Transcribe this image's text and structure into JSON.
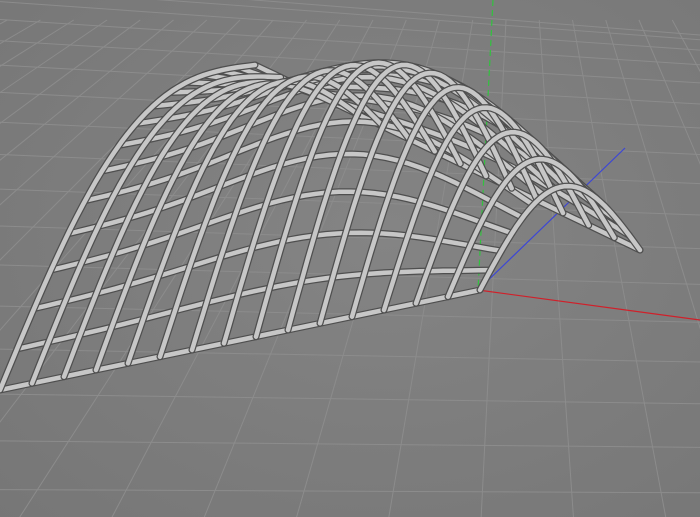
{
  "viewport": {
    "background": "#7d7d7d",
    "floor_grid_color": "#8c8c8c",
    "mesh_tube_color": "#c7c7c7",
    "mesh_tube_shadow": "#4f4f4f",
    "axis_colors": {
      "x": "#d0202a",
      "y": "#31c23e",
      "z": "#3c46d6"
    },
    "view_type": "perspective",
    "object": "deformed-wireframe-grid-surface",
    "grid_visible": true
  }
}
